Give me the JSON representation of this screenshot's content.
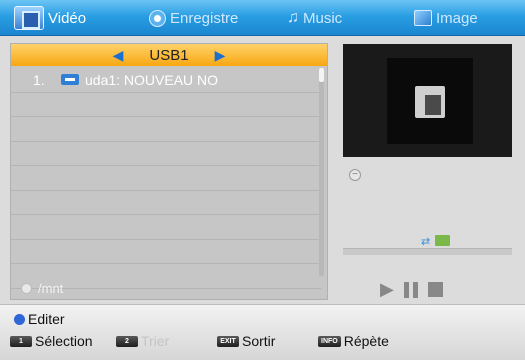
{
  "tabs": [
    {
      "label": "Vidéo",
      "icon": "video-icon",
      "active": true
    },
    {
      "label": "Enregistre",
      "icon": "record-icon",
      "active": false
    },
    {
      "label": "Music",
      "icon": "music-note-icon",
      "active": false
    },
    {
      "label": "Image",
      "icon": "image-icon",
      "active": false
    }
  ],
  "browser": {
    "device": "USB1",
    "items": [
      {
        "index": "1.",
        "label": "uda1: NOUVEAU NO",
        "icon": "usb-icon"
      }
    ],
    "path": "/mnt"
  },
  "help": {
    "editer": "Editer",
    "key1": "1",
    "selection": "Sélection",
    "key2": "2",
    "trier": "Trier",
    "key_exit": "EXIT",
    "sortir": "Sortir",
    "key_info": "INFO",
    "repete": "Répète"
  },
  "colors": {
    "tabbar": "#2a9ee3",
    "selected_bar": "#f7a712",
    "accent_blue": "#2e66d6"
  }
}
